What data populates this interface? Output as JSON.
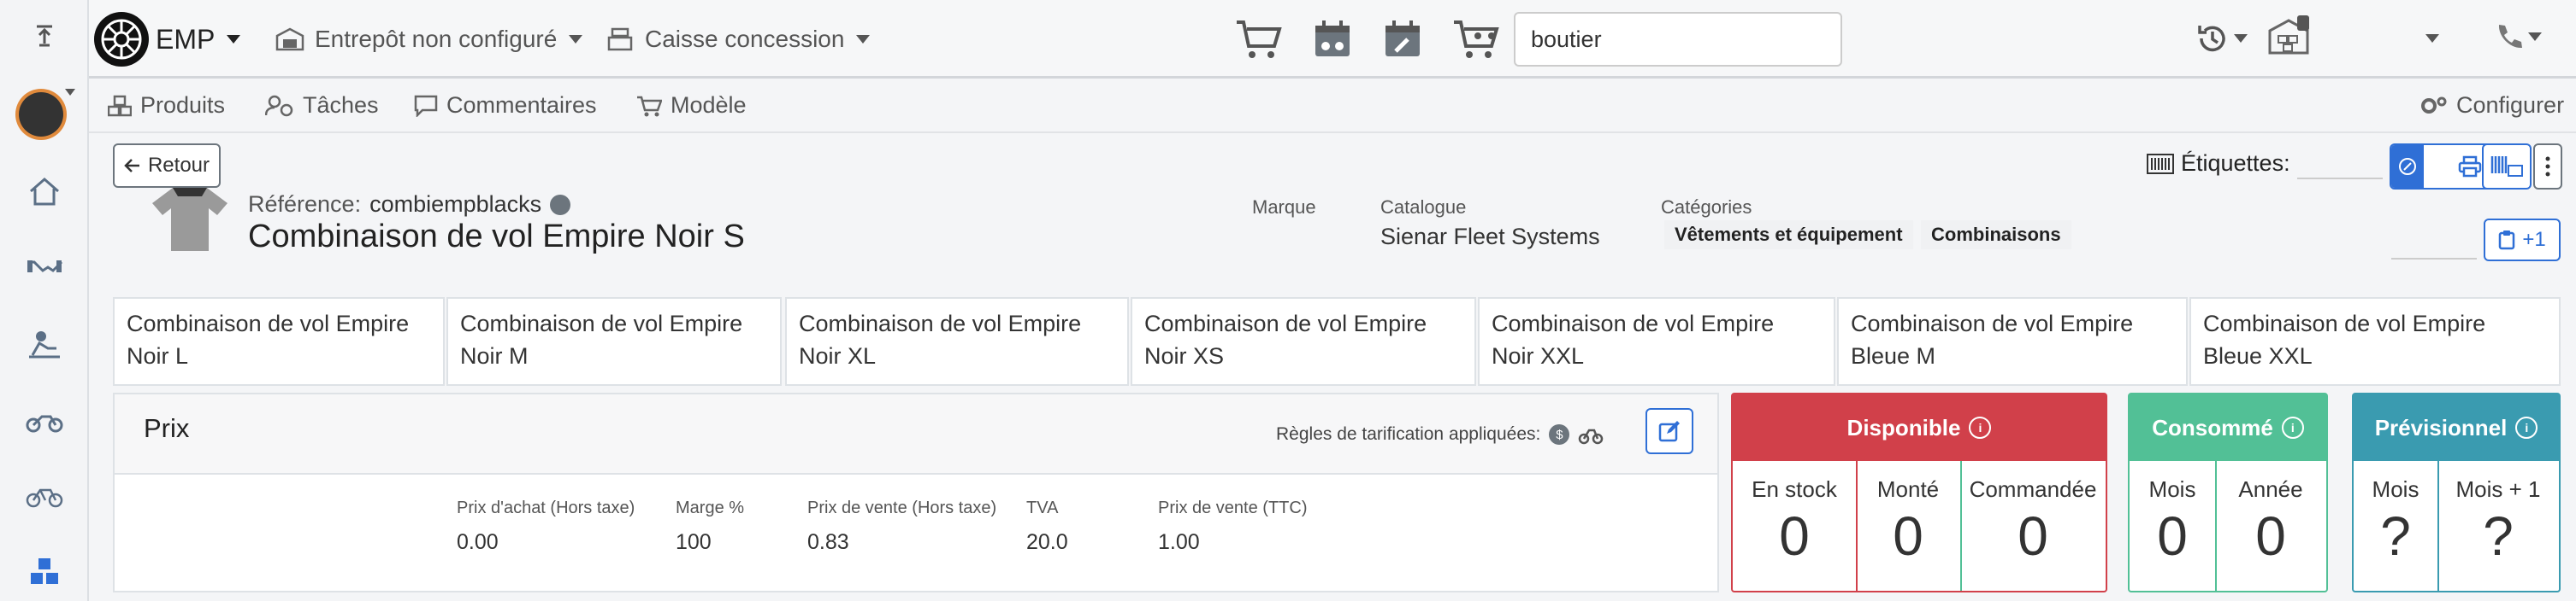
{
  "topbar": {
    "brand": "EMP",
    "warehouse": "Entrepôt non configuré",
    "register": "Caisse concession",
    "search_value": "boutier"
  },
  "tabs": [
    {
      "label": "Produits"
    },
    {
      "label": "Tâches"
    },
    {
      "label": "Commentaires"
    },
    {
      "label": "Modèle"
    }
  ],
  "configure_label": "Configurer",
  "back_label": "Retour",
  "labels_title": "Étiquettes:",
  "clipboard_count": "+1",
  "product": {
    "ref_label": "Référence:",
    "ref_value": "combiempblacks",
    "title": "Combinaison de vol Empire Noir S",
    "brand_label": "Marque",
    "catalog_label": "Catalogue",
    "catalog_value": "Sienar Fleet Systems",
    "categories_label": "Catégories",
    "categories": [
      "Vêtements et équipement",
      "Combinaisons"
    ]
  },
  "variants": [
    "Combinaison de vol Empire Noir L",
    "Combinaison de vol Empire Noir M",
    "Combinaison de vol Empire Noir XL",
    "Combinaison de vol Empire Noir XS",
    "Combinaison de vol Empire Noir XXL",
    "Combinaison de vol Empire Bleue M",
    "Combinaison de vol Empire Bleue XXL"
  ],
  "price": {
    "title": "Prix",
    "rules_label": "Règles de tarification appliquées:",
    "columns": [
      {
        "label": "Prix d'achat (Hors taxe)",
        "value": "0.00"
      },
      {
        "label": "Marge %",
        "value": "100"
      },
      {
        "label": "Prix de vente (Hors taxe)",
        "value": "0.83"
      },
      {
        "label": "TVA",
        "value": "20.0"
      },
      {
        "label": "Prix de vente (TTC)",
        "value": "1.00"
      }
    ]
  },
  "stock_cards": {
    "disponible": {
      "title": "Disponible",
      "color": "#d1404a",
      "cols": [
        {
          "label": "En stock",
          "value": "0"
        },
        {
          "label": "Monté",
          "value": "0"
        },
        {
          "label": "Commandée",
          "value": "0"
        }
      ]
    },
    "consomme": {
      "title": "Consommé",
      "color": "#52c096",
      "cols": [
        {
          "label": "Mois",
          "value": "0"
        },
        {
          "label": "Année",
          "value": "0"
        }
      ]
    },
    "previsionnel": {
      "title": "Prévisionnel",
      "color": "#3a9bb0",
      "cols": [
        {
          "label": "Mois",
          "value": "?"
        },
        {
          "label": "Mois + 1",
          "value": "?"
        }
      ]
    }
  }
}
